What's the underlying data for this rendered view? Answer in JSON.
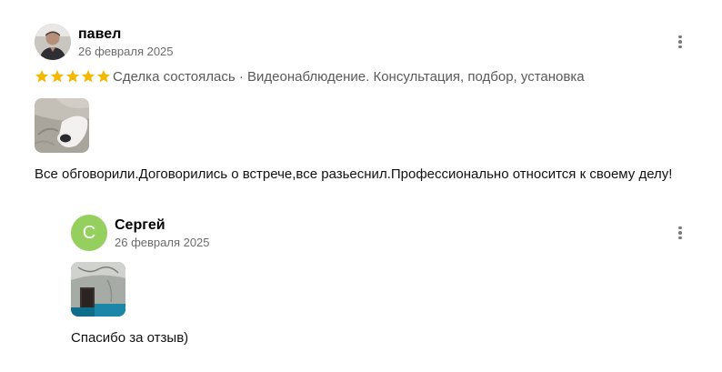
{
  "review": {
    "author_name": "павел",
    "date": "26 февраля 2025",
    "rating": 5,
    "meta": "Сделка состоялась · Видеонаблюдение. Консультация, подбор, установка",
    "text": "Все обговорили.Договорились о встрече,все разьеснил.Профессионально относится к своему делу!",
    "avatar_icon": "user-photo",
    "star_color": "#f5b800"
  },
  "reply": {
    "author_name": "Сергей",
    "avatar_letter": "С",
    "avatar_color": "#95cf5e",
    "date": "26 февраля 2025",
    "text": "Спасибо за отзыв)"
  }
}
